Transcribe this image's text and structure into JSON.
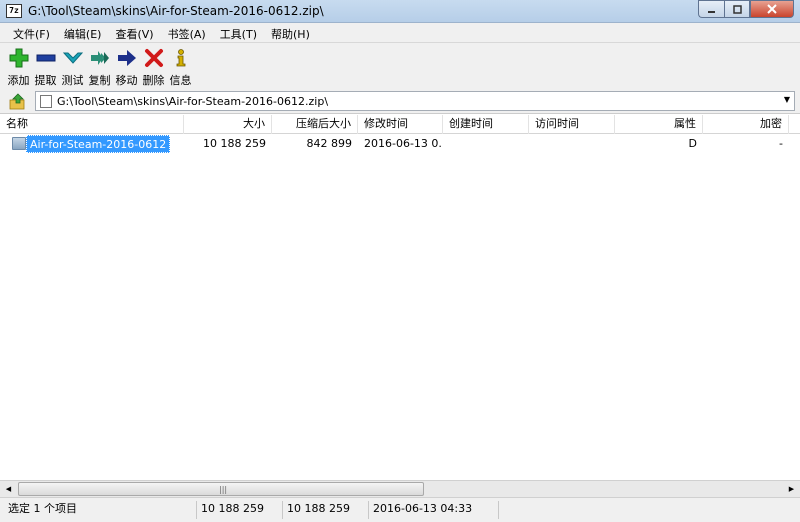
{
  "window": {
    "title": "G:\\Tool\\Steam\\skins\\Air-for-Steam-2016-0612.zip\\",
    "app_icon_text": "7z"
  },
  "menu": [
    {
      "label": "文件(F)"
    },
    {
      "label": "编辑(E)"
    },
    {
      "label": "查看(V)"
    },
    {
      "label": "书签(A)"
    },
    {
      "label": "工具(T)"
    },
    {
      "label": "帮助(H)"
    }
  ],
  "toolbar": [
    {
      "label": "添加",
      "icon": "plus-icon",
      "color": "#2fb52f"
    },
    {
      "label": "提取",
      "icon": "minus-icon",
      "color": "#1f3f9f"
    },
    {
      "label": "测试",
      "icon": "check-chevron-icon",
      "color": "#1aa3b8"
    },
    {
      "label": "复制",
      "icon": "double-arrow-icon",
      "color": "#2a8f77"
    },
    {
      "label": "移动",
      "icon": "arrow-right-icon",
      "color": "#1c2f8a"
    },
    {
      "label": "删除",
      "icon": "x-icon",
      "color": "#d11a1a"
    },
    {
      "label": "信息",
      "icon": "info-icon",
      "color": "#d4b000"
    }
  ],
  "address": {
    "path": "G:\\Tool\\Steam\\skins\\Air-for-Steam-2016-0612.zip\\"
  },
  "columns": [
    "名称",
    "大小",
    "压缩后大小",
    "修改时间",
    "创建时间",
    "访问时间",
    "属性",
    "加密"
  ],
  "rows": [
    {
      "name": "Air-for-Steam-2016-0612",
      "size": "10 188 259",
      "packed": "842 899",
      "modified": "2016-06-13 0...",
      "created": "",
      "accessed": "",
      "attr": "D",
      "encrypted": "-"
    }
  ],
  "status": {
    "selection": "选定 1 个项目",
    "size": "10 188 259",
    "size2": "10 188 259",
    "date": "2016-06-13 04:33"
  }
}
